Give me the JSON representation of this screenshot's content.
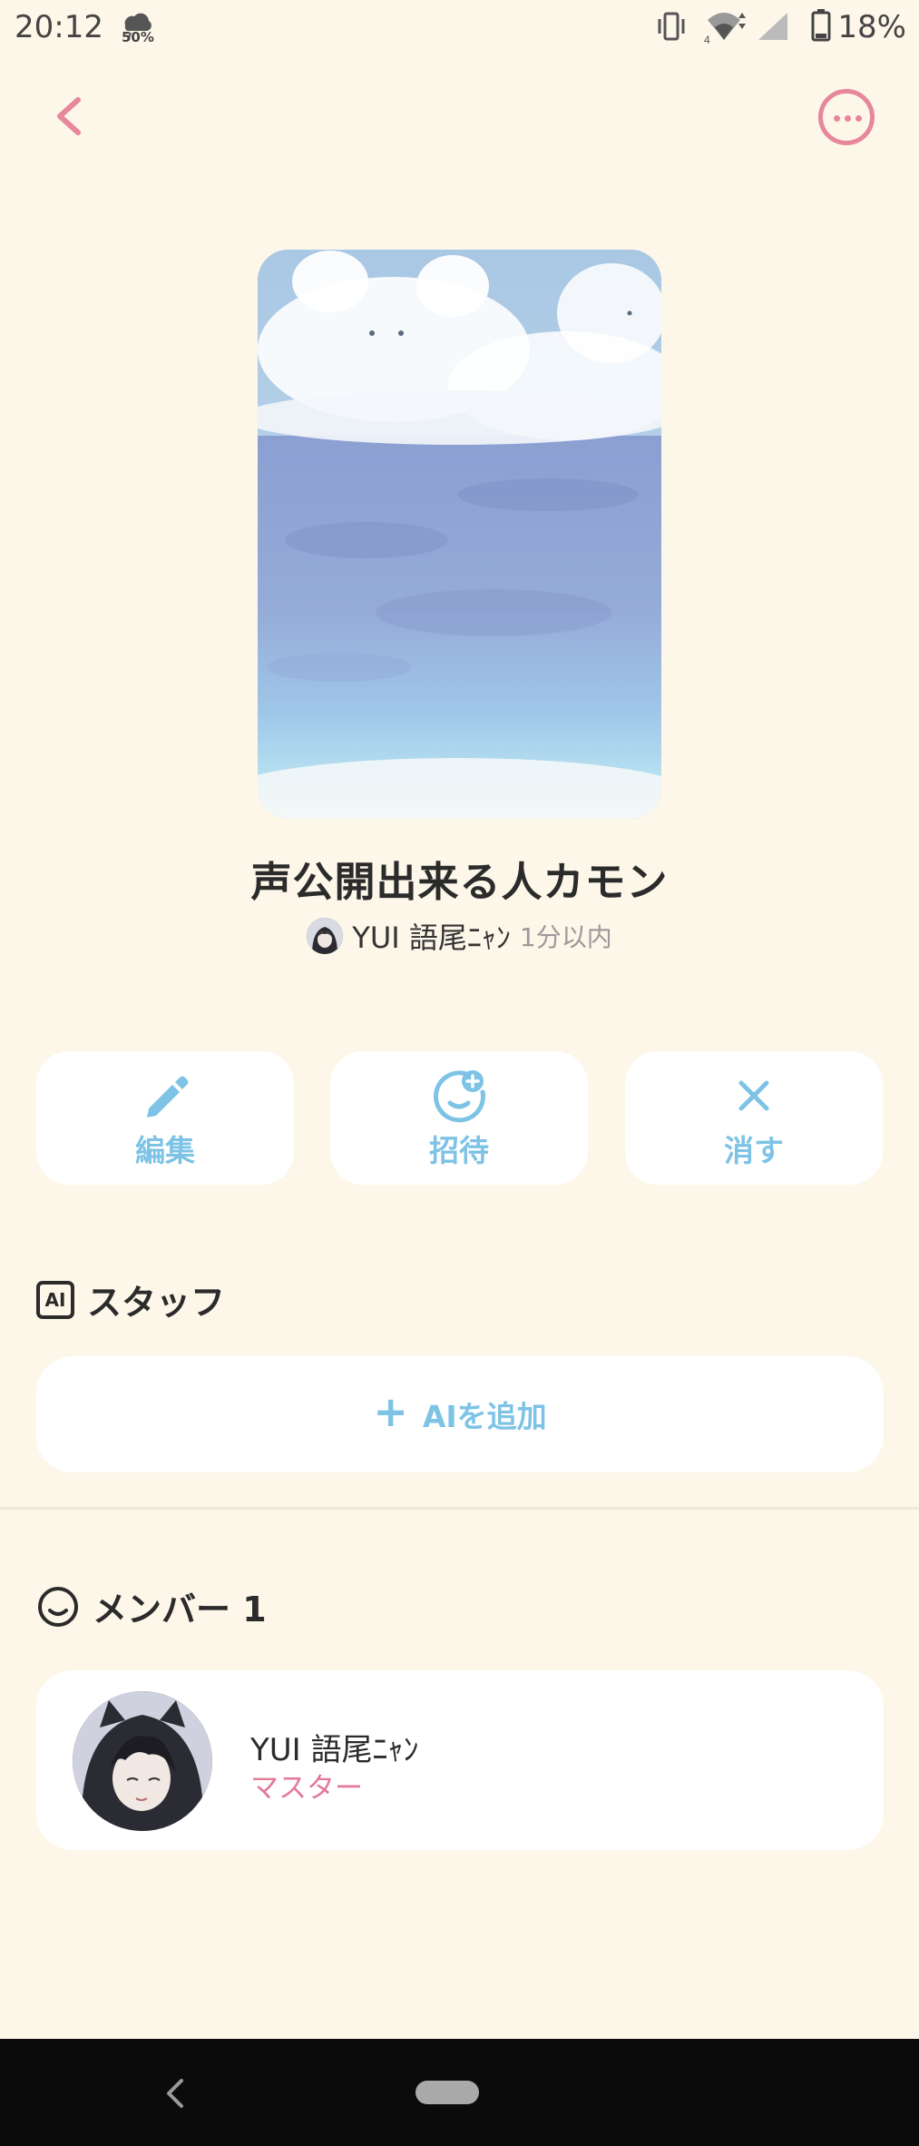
{
  "status_bar": {
    "time": "20:12",
    "weather_label": "50%",
    "battery": "18%"
  },
  "header": {
    "back_icon": "chevron-left-icon",
    "more_icon": "more-horizontal-icon"
  },
  "room": {
    "title": "声公開出来る人カモン",
    "owner_name": "YUI 語尾ﾆｬﾝ",
    "time_ago": "1分以内"
  },
  "actions": [
    {
      "label": "編集",
      "icon": "pencil-icon"
    },
    {
      "label": "招待",
      "icon": "invite-face-plus-icon"
    },
    {
      "label": "消す",
      "icon": "close-icon"
    }
  ],
  "staff_section": {
    "icon_text": "AI",
    "title": "スタッフ",
    "add_label": "AIを追加"
  },
  "members_section": {
    "title": "メンバー 1",
    "members": [
      {
        "name": "YUI 語尾ﾆｬﾝ",
        "role": "マスター"
      }
    ]
  },
  "colors": {
    "background": "#fdf7e9",
    "accent_blue": "#7ec3e5",
    "accent_pink": "#e7879b",
    "role_pink": "#e27a98"
  }
}
